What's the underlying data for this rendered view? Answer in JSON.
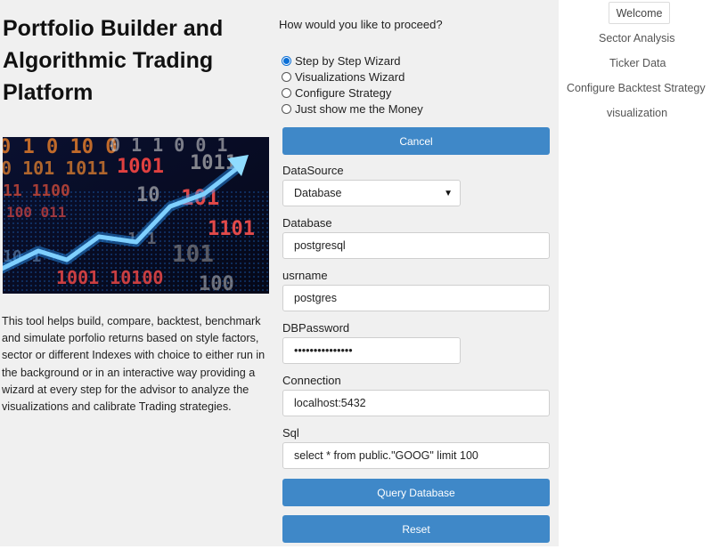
{
  "page": {
    "title": "Portfolio Builder and Algorithmic Trading Platform",
    "description": "This tool helps build, compare, backtest, benchmark and simulate porfolio returns based on style factors, sector or different Indexes with choice to either run in the background or in an interactive way providing a wizard at every step for the advisor to analyze the visualizations and calibrate Trading strategies."
  },
  "hero_image": {
    "icon": "trading-chart-illustration"
  },
  "wizard": {
    "question": "How would you like to proceed?",
    "options": [
      {
        "label": "Step by Step Wizard",
        "selected": true
      },
      {
        "label": "Visualizations Wizard",
        "selected": false
      },
      {
        "label": "Configure Strategy",
        "selected": false
      },
      {
        "label": "Just show me the Money",
        "selected": false
      }
    ],
    "cancel_label": "Cancel"
  },
  "form": {
    "datasource": {
      "label": "DataSource",
      "value": "Database"
    },
    "database": {
      "label": "Database",
      "value": "postgresql"
    },
    "username": {
      "label": "usrname",
      "value": "postgres"
    },
    "password": {
      "label": "DBPassword",
      "value": "•••••••••••••••"
    },
    "connection": {
      "label": "Connection",
      "value": "localhost:5432"
    },
    "sql": {
      "label": "Sql",
      "value": "select * from public.\"GOOG\" limit 100"
    },
    "query_label": "Query Database",
    "reset_label": "Reset"
  },
  "nav": {
    "items": [
      "Welcome",
      "Sector Analysis",
      "Ticker Data",
      "Configure Backtest Strategy",
      "visualization"
    ],
    "active": "Welcome"
  },
  "colors": {
    "button": "#3f88c8",
    "panel": "#f0f0f0",
    "radio_selected": "#0b6fd6"
  }
}
